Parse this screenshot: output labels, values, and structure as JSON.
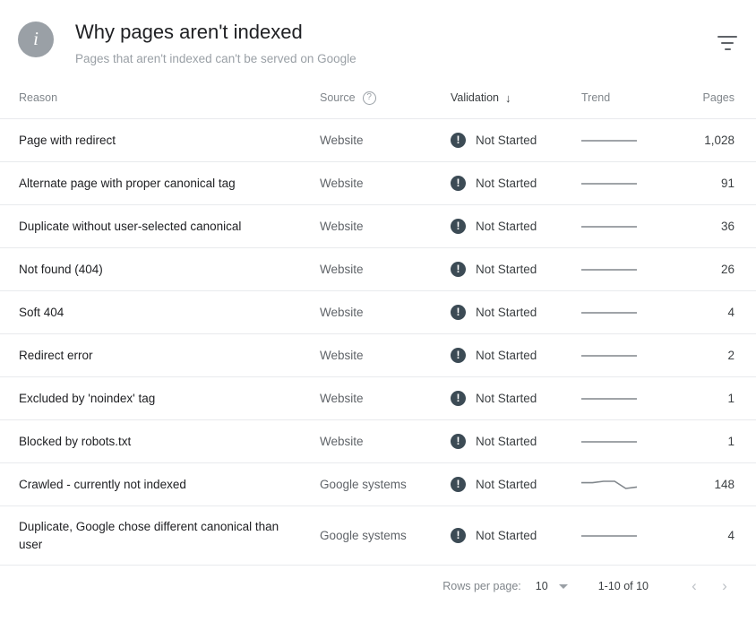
{
  "header": {
    "info_icon": "info-icon",
    "title": "Why pages aren't indexed",
    "subtitle": "Pages that aren't indexed can't be served on Google",
    "filter_icon": "filter-list-icon"
  },
  "table": {
    "columns": {
      "reason": "Reason",
      "source": "Source",
      "source_help_icon": "help-circle-icon",
      "validation": "Validation",
      "validation_sort_arrow": "↓",
      "trend": "Trend",
      "pages": "Pages"
    },
    "rows": [
      {
        "reason": "Page with redirect",
        "source": "Website",
        "status_icon": "exclamation-circle-icon",
        "validation": "Not Started",
        "trend": "flat",
        "pages": "1,028"
      },
      {
        "reason": "Alternate page with proper canonical tag",
        "source": "Website",
        "status_icon": "exclamation-circle-icon",
        "validation": "Not Started",
        "trend": "flat",
        "pages": "91"
      },
      {
        "reason": "Duplicate without user-selected canonical",
        "source": "Website",
        "status_icon": "exclamation-circle-icon",
        "validation": "Not Started",
        "trend": "flat",
        "pages": "36"
      },
      {
        "reason": "Not found (404)",
        "source": "Website",
        "status_icon": "exclamation-circle-icon",
        "validation": "Not Started",
        "trend": "flat",
        "pages": "26"
      },
      {
        "reason": "Soft 404",
        "source": "Website",
        "status_icon": "exclamation-circle-icon",
        "validation": "Not Started",
        "trend": "flat",
        "pages": "4"
      },
      {
        "reason": "Redirect error",
        "source": "Website",
        "status_icon": "exclamation-circle-icon",
        "validation": "Not Started",
        "trend": "flat",
        "pages": "2"
      },
      {
        "reason": "Excluded by 'noindex' tag",
        "source": "Website",
        "status_icon": "exclamation-circle-icon",
        "validation": "Not Started",
        "trend": "flat",
        "pages": "1"
      },
      {
        "reason": "Blocked by robots.txt",
        "source": "Website",
        "status_icon": "exclamation-circle-icon",
        "validation": "Not Started",
        "trend": "flat",
        "pages": "1"
      },
      {
        "reason": "Crawled - currently not indexed",
        "source": "Google systems",
        "status_icon": "exclamation-circle-icon",
        "validation": "Not Started",
        "trend": "dip",
        "pages": "148"
      },
      {
        "reason": "Duplicate, Google chose different canonical than user",
        "source": "Google systems",
        "status_icon": "exclamation-circle-icon",
        "validation": "Not Started",
        "trend": "flat",
        "pages": "4"
      }
    ]
  },
  "footer": {
    "rows_per_page_label": "Rows per page:",
    "rows_per_page_value": "10",
    "range_label": "1-10 of 10",
    "prev_icon": "‹",
    "next_icon": "›"
  },
  "colors": {
    "status_icon": "#3c4b55",
    "info_badge": "#9aa0a6",
    "text_primary": "#202124",
    "text_secondary": "#5f6368",
    "text_muted": "#80868b",
    "divider": "#e8eaed",
    "sparkline": "#80868b"
  },
  "chart_data": {
    "type": "line",
    "title": "Trend sparklines",
    "series": [
      {
        "name": "flat",
        "x": [
          0,
          1,
          2,
          3,
          4,
          5
        ],
        "values": [
          1,
          1,
          1,
          1,
          1,
          1
        ]
      },
      {
        "name": "dip",
        "x": [
          0,
          1,
          2,
          3,
          4,
          5
        ],
        "values": [
          1,
          1,
          1.05,
          1.05,
          0.8,
          0.85
        ]
      }
    ],
    "grid": false,
    "legend": "none"
  }
}
